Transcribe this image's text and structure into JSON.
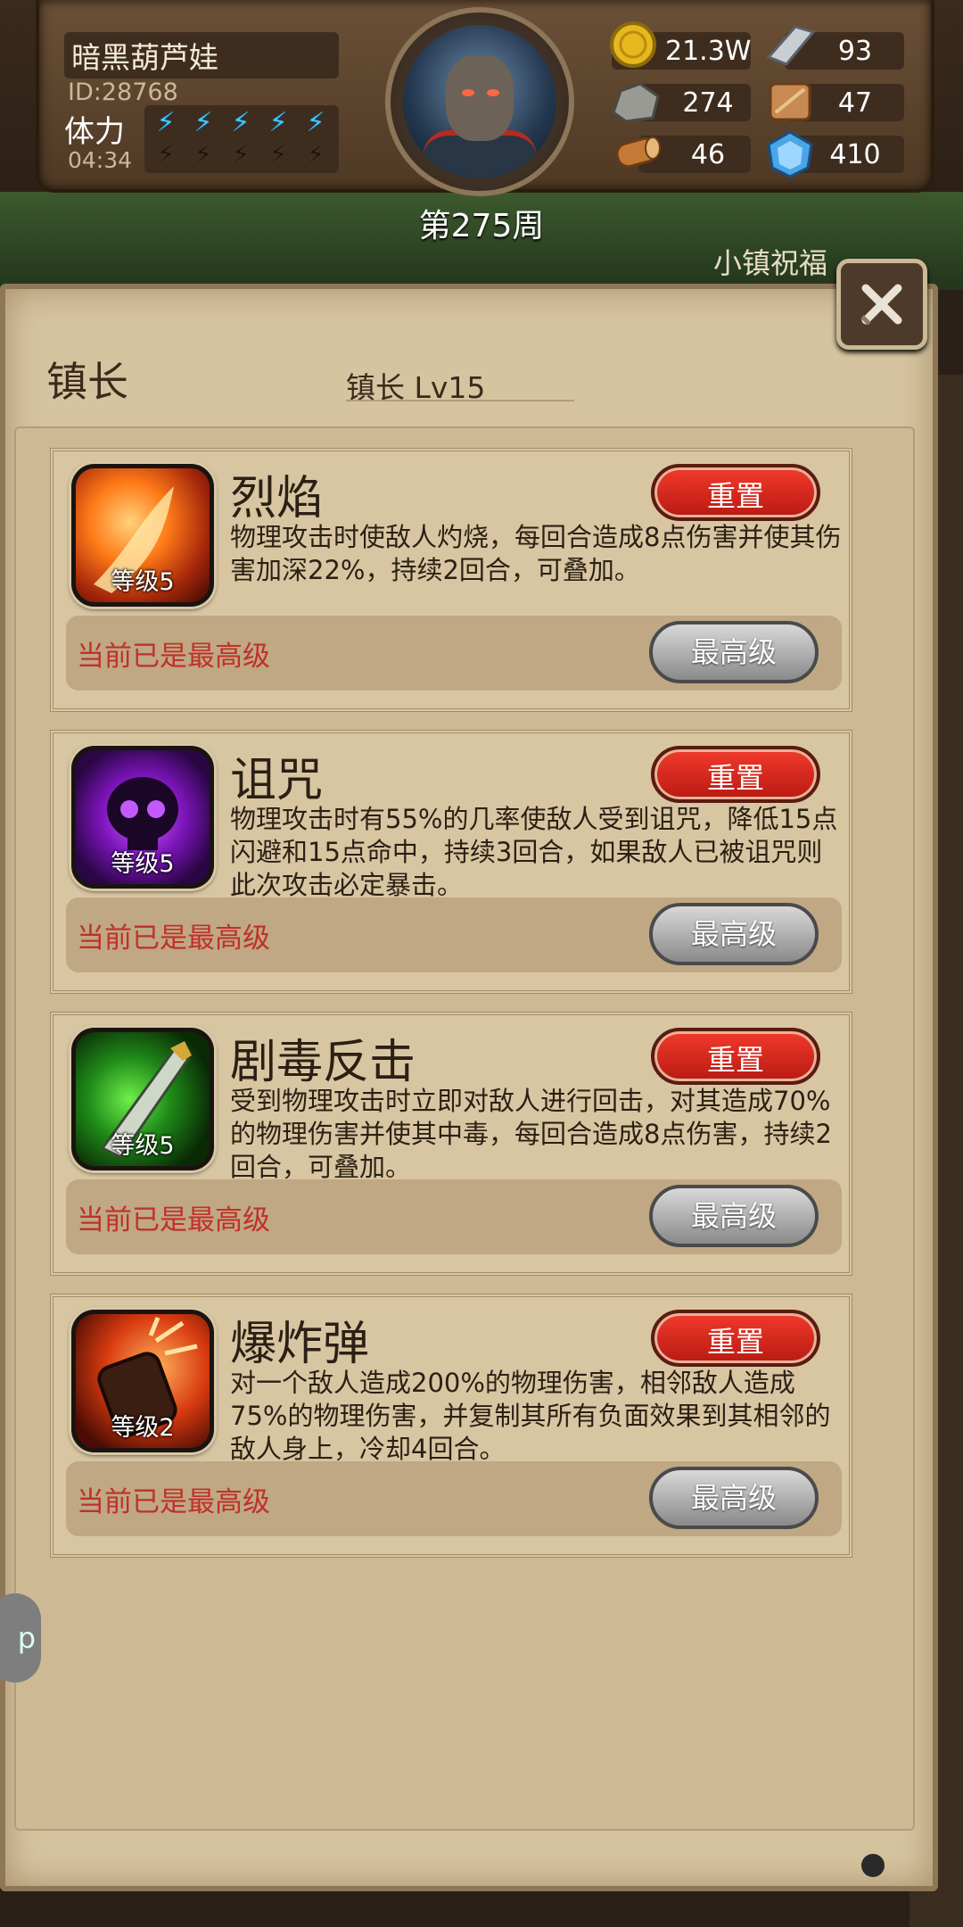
{
  "player": {
    "name": "暗黑葫芦娃",
    "id_text": "ID:28768",
    "stamina_label": "体力",
    "stamina_timer": "04:34",
    "stamina_filled": 5,
    "stamina_max": 10,
    "week_text": "第275周"
  },
  "resources": [
    {
      "icon": "gold-coin-icon",
      "value": "21.3W"
    },
    {
      "icon": "iron-ingot-icon",
      "value": "93"
    },
    {
      "icon": "stone-icon",
      "value": "274"
    },
    {
      "icon": "leather-icon",
      "value": "47"
    },
    {
      "icon": "wood-log-icon",
      "value": "46"
    },
    {
      "icon": "crystal-icon",
      "value": "410"
    }
  ],
  "background_label": "小镇祝福",
  "panel": {
    "title": "镇长",
    "level_text": "镇长 Lv15"
  },
  "skills": [
    {
      "name": "烈焰",
      "icon": "flame-skill-icon",
      "level_label": "等级5",
      "description": "物理攻击时使敌人灼烧，每回合造成8点伤害并使其伤害加深22%，持续2回合，可叠加。",
      "reset_label": "重置",
      "status_text": "当前已是最高级",
      "max_label": "最高级"
    },
    {
      "name": "诅咒",
      "icon": "curse-skull-icon",
      "level_label": "等级5",
      "description": "物理攻击时有55%的几率使敌人受到诅咒，降低15点闪避和15点命中，持续3回合，如果敌人已被诅咒则此次攻击必定暴击。",
      "reset_label": "重置",
      "status_text": "当前已是最高级",
      "max_label": "最高级"
    },
    {
      "name": "剧毒反击",
      "icon": "poison-blade-icon",
      "level_label": "等级5",
      "description": "受到物理攻击时立即对敌人进行回击，对其造成70%的物理伤害并使其中毒，每回合造成8点伤害，持续2回合，可叠加。",
      "reset_label": "重置",
      "status_text": "当前已是最高级",
      "max_label": "最高级"
    },
    {
      "name": "爆炸弹",
      "icon": "explosive-bomb-icon",
      "level_label": "等级2",
      "description": "对一个敌人造成200%的物理伤害，相邻敌人造成75%的物理伤害，并复制其所有负面效果到其相邻的敌人身上，冷却4回合。",
      "reset_label": "重置",
      "status_text": "当前已是最高级",
      "max_label": "最高级"
    }
  ],
  "floating_app_text": "p"
}
